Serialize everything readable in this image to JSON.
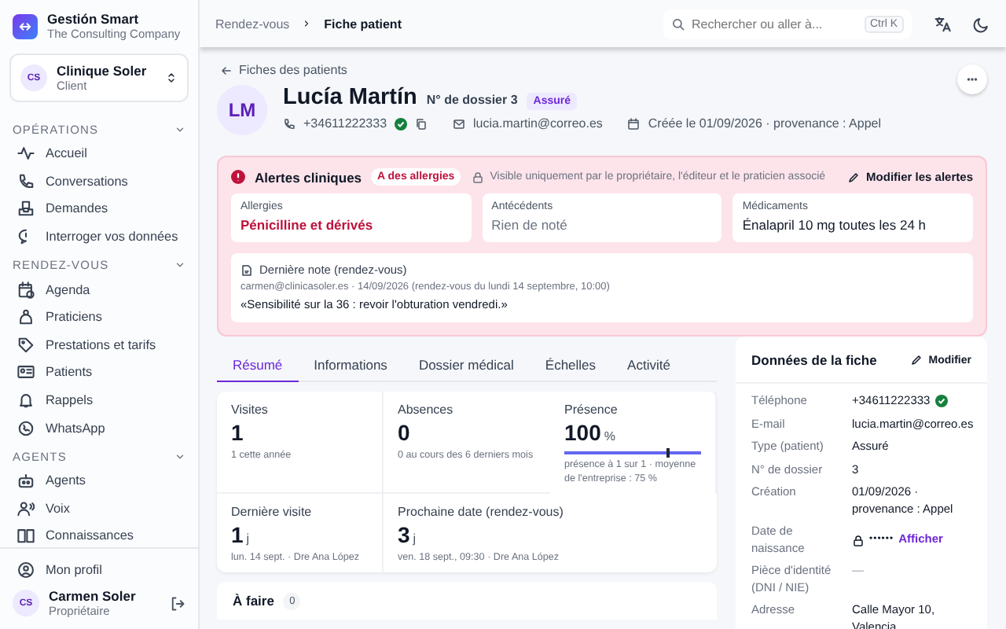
{
  "brand": {
    "name": "Gestión Smart",
    "subtitle": "The Consulting Company"
  },
  "workspace": {
    "initials": "CS",
    "name": "Clinique Soler",
    "role": "Client"
  },
  "sidebar": {
    "sections": [
      {
        "title": "OPÉRATIONS",
        "expanded": true,
        "items": [
          "Accueil",
          "Conversations",
          "Demandes",
          "Interroger vos données"
        ]
      },
      {
        "title": "RENDEZ-VOUS",
        "expanded": true,
        "items": [
          "Agenda",
          "Praticiens",
          "Prestations et tarifs",
          "Patients",
          "Rappels",
          "WhatsApp"
        ]
      },
      {
        "title": "AGENTS",
        "expanded": true,
        "items": [
          "Agents",
          "Voix",
          "Connaissances"
        ]
      }
    ],
    "profile_link": "Mon profil",
    "user": {
      "initials": "CS",
      "name": "Carmen Soler",
      "role": "Propriétaire"
    }
  },
  "topbar": {
    "breadcrumbs": [
      "Rendez-vous",
      "Fiche patient"
    ],
    "search": {
      "placeholder": "Rechercher ou aller à...",
      "shortcut": "Ctrl K"
    }
  },
  "patient": {
    "back_link": "Fiches des patients",
    "initials": "LM",
    "name": "Lucía Martín",
    "file_number": "N° de dossier 3",
    "badge": "Assuré",
    "phone": "+34611222333",
    "phone_verified": true,
    "email": "lucia.martin@correo.es",
    "created": "Créée le 01/09/2026 · provenance : Appel"
  },
  "alerts": {
    "title": "Alertes cliniques",
    "badge": "A des allergies",
    "visibility": "Visible uniquement par le propriétaire, l'éditeur et le praticien associé",
    "edit": "Modifier les alertes",
    "fields": [
      {
        "label": "Allergies",
        "value": "Pénicilline et dérivés",
        "kind": "alert"
      },
      {
        "label": "Antécédents",
        "value": "Rien de noté",
        "kind": "empty"
      },
      {
        "label": "Médicaments",
        "value": "Énalapril 10 mg toutes les 24 h",
        "kind": "normal"
      }
    ],
    "note": {
      "title": "Dernière note (rendez-vous)",
      "meta": "carmen@clinicasoler.es · 14/09/2026 (rendez-vous du lundi 14 septembre, 10:00)",
      "text": "«Sensibilité sur la 36 : revoir l'obturation vendredi.»"
    }
  },
  "tabs": [
    {
      "label": "Résumé",
      "selected": true
    },
    {
      "label": "Informations",
      "selected": false
    },
    {
      "label": "Dossier médical",
      "selected": false
    },
    {
      "label": "Échelles",
      "selected": false
    },
    {
      "label": "Activité",
      "selected": false
    }
  ],
  "stats": [
    {
      "kind": "plain",
      "label": "Visites",
      "value": "1",
      "detail": "1 cette année"
    },
    {
      "kind": "plain",
      "label": "Absences",
      "value": "0",
      "detail": "0 au cours des 6 derniers mois"
    },
    {
      "kind": "meter",
      "label": "Présence",
      "value": "100",
      "unit": "%",
      "level": 1,
      "average": {
        "level": 0.75
      },
      "detail": "présence à 1 sur 1 · moyenne de l'entreprise : 75 %"
    },
    {
      "kind": "plain",
      "label": "Dernière visite",
      "value": "1",
      "unit": "j",
      "detail": "lun. 14 sept. · Dre Ana López"
    },
    {
      "kind": "wide",
      "label": "Prochaine date (rendez-vous)",
      "value": "3",
      "unit": "j",
      "detail": "ven. 18 sept., 09:30 · Dre Ana López"
    }
  ],
  "todo": {
    "title": "À faire",
    "count": "0"
  },
  "record": {
    "title": "Données de la fiche",
    "edit": "Modifier",
    "rows": [
      {
        "kind": "verified",
        "label": "Téléphone",
        "value": "+34611222333"
      },
      {
        "kind": "text",
        "label": "E-mail",
        "value": "lucia.martin@correo.es"
      },
      {
        "kind": "text",
        "label": "Type (patient)",
        "value": "Assuré"
      },
      {
        "kind": "text",
        "label": "N° de dossier",
        "value": "3"
      },
      {
        "kind": "text",
        "label": "Création",
        "value": "01/09/2026 · provenance : Appel"
      },
      {
        "kind": "hidden",
        "label": "Date de naissance",
        "value": "••••••",
        "action": "Afficher"
      },
      {
        "kind": "empty",
        "label": "Pièce d'identité (DNI / NIE)",
        "value": "—"
      },
      {
        "kind": "text",
        "label": "Adresse",
        "value": "Calle Mayor 10, Valencia"
      }
    ]
  }
}
